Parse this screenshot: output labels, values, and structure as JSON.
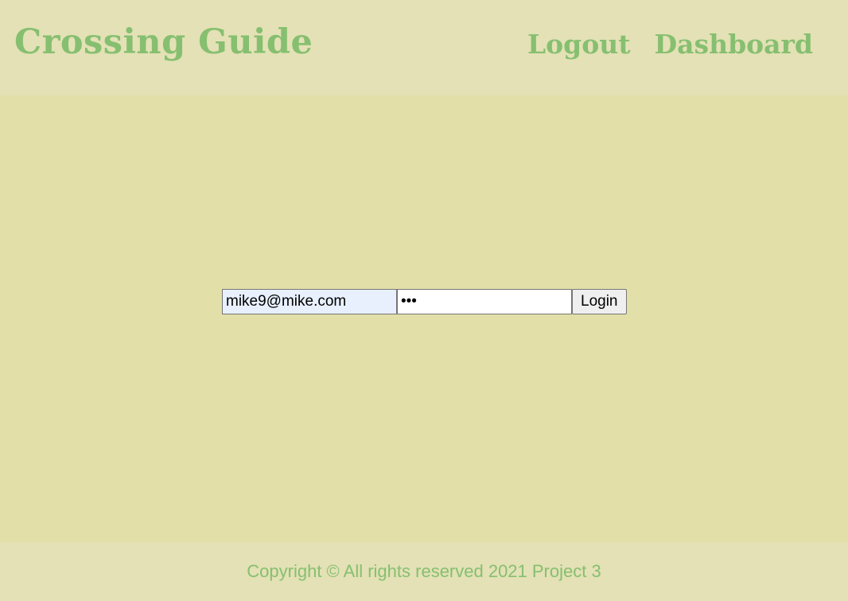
{
  "header": {
    "brand": "Crossing Guide",
    "nav": {
      "logout_label": "Logout",
      "dashboard_label": "Dashboard"
    }
  },
  "login_form": {
    "email_value": "mike9@mike.com",
    "password_value": "abc",
    "submit_label": "Login"
  },
  "footer": {
    "copyright": "Copyright © All rights reserved 2021 Project 3"
  },
  "colors": {
    "header_bg": "#e3e1b5",
    "main_bg": "#e2dfa9",
    "accent_green": "#86bf70",
    "autofill_bg": "#e8f0fe"
  }
}
